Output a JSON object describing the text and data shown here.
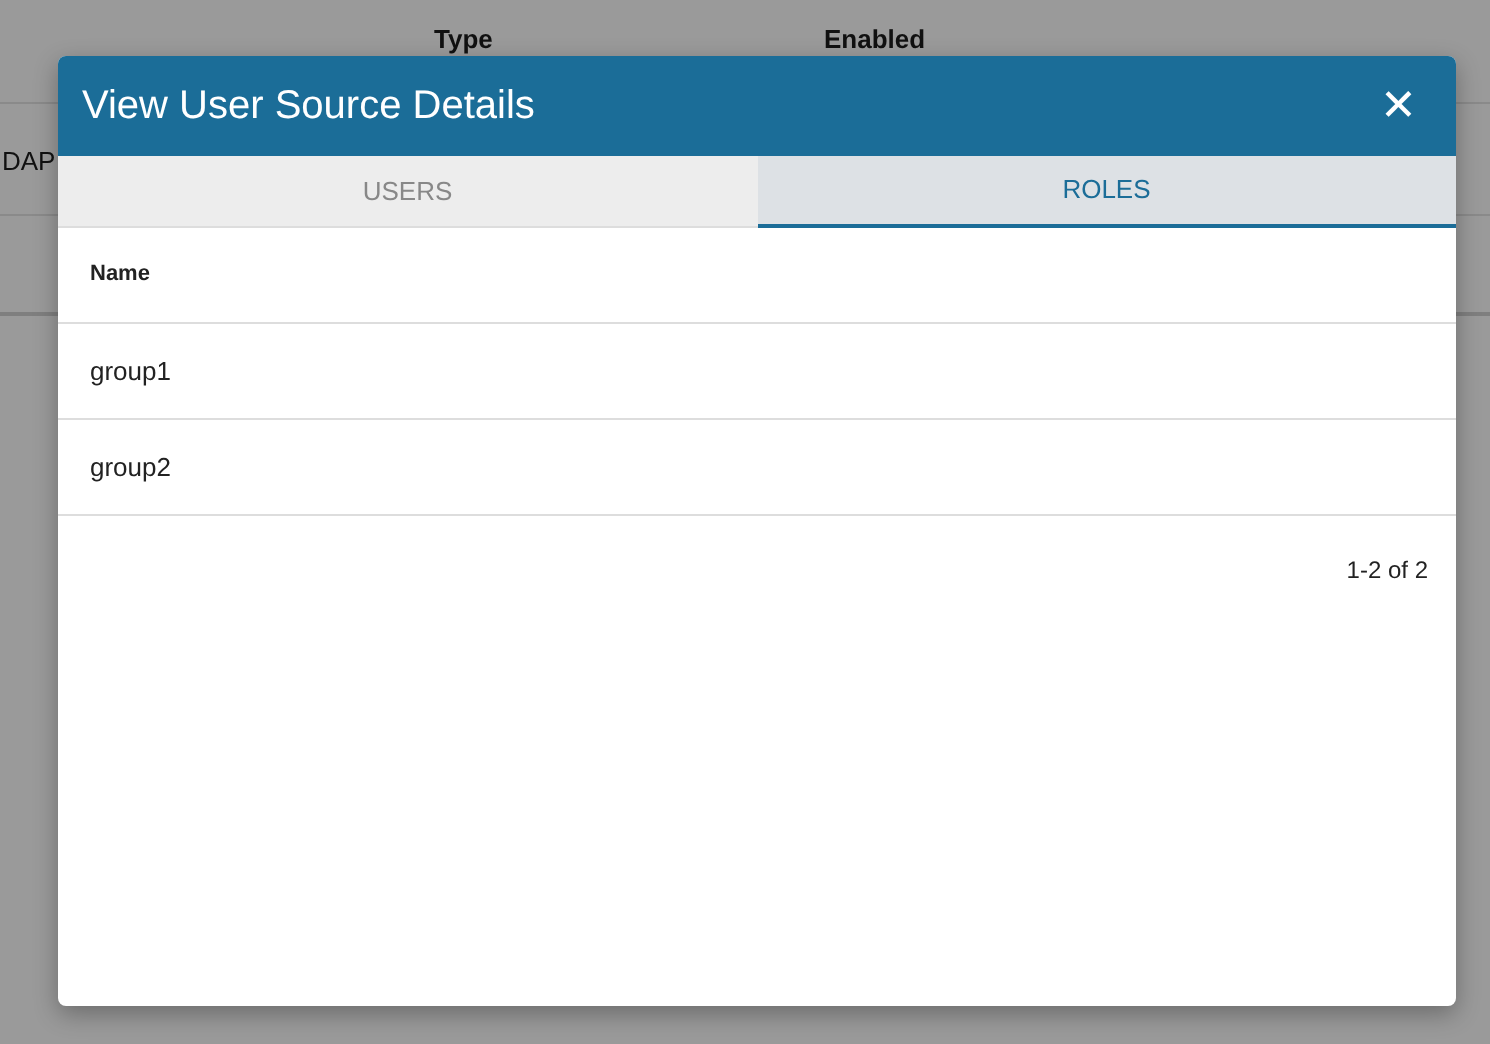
{
  "background_table": {
    "columns": [
      "",
      "Type",
      "Enabled"
    ],
    "rows": [
      [
        "DAP",
        "",
        ""
      ]
    ]
  },
  "dialog": {
    "title": "View User Source Details",
    "close": "✕",
    "tabs": [
      {
        "label": "USERS",
        "selected": false
      },
      {
        "label": "ROLES",
        "selected": true
      }
    ],
    "table": {
      "columns": [
        "Name"
      ],
      "rows": [
        [
          "group1"
        ],
        [
          "group2"
        ]
      ]
    },
    "pagination": "1-2 of 2"
  }
}
